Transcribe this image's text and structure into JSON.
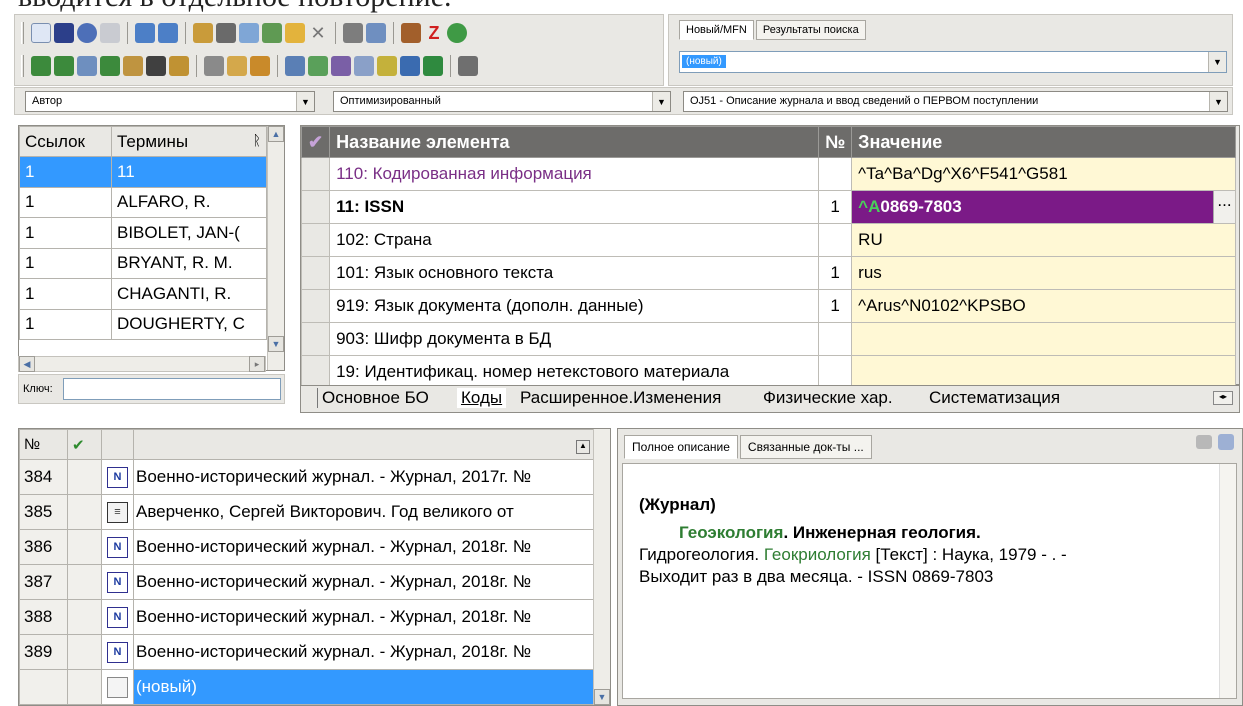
{
  "page": {
    "heading_fragment": "вводится в отдельное повторение."
  },
  "mfn": {
    "tabs": [
      "Новый/MFN",
      "Результаты поиска"
    ],
    "selected": "(новый)"
  },
  "filters": {
    "search_field": "Автор",
    "mode": "Оптимизированный",
    "worksheet": "OJ51 - Описание журнала и ввод сведений о ПЕРВОМ поступлении"
  },
  "terms": {
    "header_count": "Ссылок",
    "header_terms": "Термины",
    "pin_icon_glyph": "ᚱ",
    "rows": [
      {
        "count": "1",
        "term": "11"
      },
      {
        "count": "1",
        "term": "ALFARO, R."
      },
      {
        "count": "1",
        "term": "BIBOLET, JAN-("
      },
      {
        "count": "1",
        "term": "BRYANT, R. M."
      },
      {
        "count": "1",
        "term": "CHAGANTI, R."
      },
      {
        "count": "1",
        "term": "DOUGHERTY, C"
      }
    ],
    "key_label": "Ключ:"
  },
  "grid": {
    "header_name": "Название элемента",
    "header_num": "№",
    "header_value": "Значение",
    "rows": [
      {
        "name": "110: Кодированная информация",
        "num": "",
        "value": "^Ta^Ba^Dg^X6^F541^G581",
        "color": "#7a2f86"
      },
      {
        "name": "11: ISSN",
        "num": "1",
        "value_prefix": "^A",
        "value": "0869-7803"
      },
      {
        "name": "102: Страна",
        "num": "",
        "value": "RU"
      },
      {
        "name": "101: Язык основного текста",
        "num": "1",
        "value": "rus"
      },
      {
        "name": "919: Язык документа (дополн. данные)",
        "num": "1",
        "value": "^Arus^N0102^KPSBO"
      },
      {
        "name": "903: Шифр документа в БД",
        "num": "",
        "value": ""
      },
      {
        "name": "19: Идентификац. номер нетекстового материала",
        "num": "",
        "value": ""
      }
    ],
    "ellipsis": "...",
    "tabs": [
      "Основное БО",
      "Коды",
      "Расширенное.Изменения",
      "Физические хар.",
      "Систематизация"
    ]
  },
  "list": {
    "header_no": "№",
    "rows": [
      {
        "no": "384",
        "icon": "N",
        "text": "Военно-исторический журнал. - Журнал, 2017г. №"
      },
      {
        "no": "385",
        "icon": "B",
        "text": "Аверченко, Сергей Викторович. Год великого от"
      },
      {
        "no": "386",
        "icon": "N",
        "text": "Военно-исторический журнал. - Журнал, 2018г. №"
      },
      {
        "no": "387",
        "icon": "N",
        "text": "Военно-исторический журнал. - Журнал, 2018г. №"
      },
      {
        "no": "388",
        "icon": "N",
        "text": "Военно-исторический журнал. - Журнал, 2018г. №"
      },
      {
        "no": "389",
        "icon": "N",
        "text": "Военно-исторический журнал. - Журнал, 2018г. №"
      },
      {
        "no": "",
        "icon": "blank",
        "text": "(новый)"
      }
    ]
  },
  "description": {
    "tabs": [
      "Полное описание",
      "Связанные док-ты ..."
    ],
    "line1": "(Журнал)",
    "title_green": "Геоэкология",
    "title_rest": ". Инженерная геология.",
    "line3_a": "Гидрогеология. ",
    "line3_green": "Геокриология",
    "line3_b": " [Текст] : Наука, 1979 - . -",
    "line4": "Выходит раз в два месяца. - ISSN 0869-7803"
  },
  "colors": {
    "selection": "#3399ff",
    "current_value_bg": "#7b1a87",
    "value_bg": "#fff8d5",
    "green_link": "#2e7d32"
  }
}
